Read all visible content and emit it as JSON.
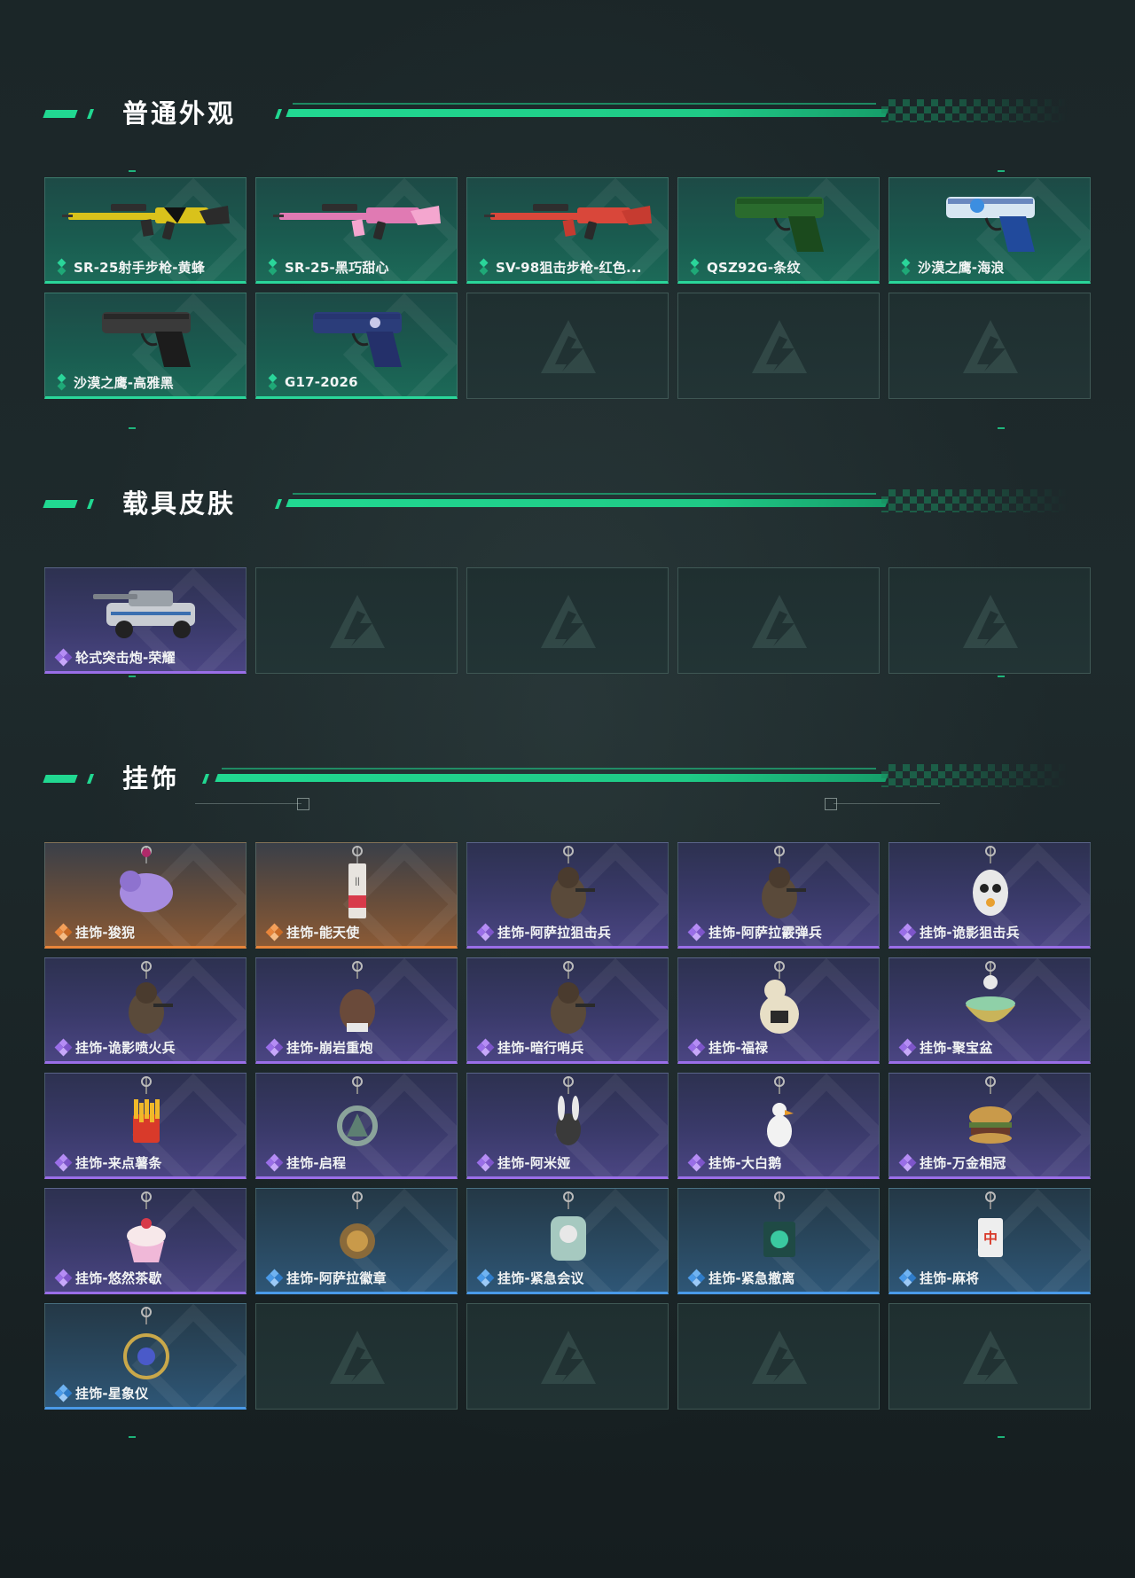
{
  "sections": [
    {
      "title": "普通外观",
      "items": [
        {
          "name": "SR-25射手步枪-黄蜂",
          "rarity": "green",
          "icon": "rifle-icon",
          "art": "rifle-yellow"
        },
        {
          "name": "SR-25-黑巧甜心",
          "rarity": "green",
          "icon": "rifle-icon",
          "art": "rifle-pink"
        },
        {
          "name": "SV-98狙击步枪-红色...",
          "rarity": "green",
          "icon": "sniper-rifle-icon",
          "art": "sniper-red"
        },
        {
          "name": "QSZ92G-条纹",
          "rarity": "green",
          "icon": "pistol-icon",
          "art": "pistol-green"
        },
        {
          "name": "沙漠之鹰-海浪",
          "rarity": "green",
          "icon": "pistol-icon",
          "art": "pistol-blue"
        },
        {
          "name": "沙漠之鹰-高雅黑",
          "rarity": "green",
          "icon": "pistol-icon",
          "art": "pistol-black"
        },
        {
          "name": "G17-2026",
          "rarity": "green",
          "icon": "pistol-icon",
          "art": "pistol-navy"
        },
        {
          "name": "",
          "rarity": "empty"
        },
        {
          "name": "",
          "rarity": "empty"
        },
        {
          "name": "",
          "rarity": "empty"
        }
      ]
    },
    {
      "title": "载具皮肤",
      "items": [
        {
          "name": "轮式突击炮-荣耀",
          "rarity": "purple",
          "icon": "vehicle-icon",
          "art": "vehicle"
        },
        {
          "name": "",
          "rarity": "empty"
        },
        {
          "name": "",
          "rarity": "empty"
        },
        {
          "name": "",
          "rarity": "empty"
        },
        {
          "name": "",
          "rarity": "empty"
        }
      ]
    },
    {
      "title": "挂饰",
      "items": [
        {
          "name": "挂饰-狻猊",
          "rarity": "orange",
          "icon": "charm-icon",
          "art": "charm-lion"
        },
        {
          "name": "挂饰-能天使",
          "rarity": "orange",
          "icon": "charm-icon",
          "art": "charm-tag"
        },
        {
          "name": "挂饰-阿萨拉狙击兵",
          "rarity": "purple",
          "icon": "charm-icon",
          "art": "charm-soldier"
        },
        {
          "name": "挂饰-阿萨拉霰弹兵",
          "rarity": "purple",
          "icon": "charm-icon",
          "art": "charm-soldier"
        },
        {
          "name": "挂饰-诡影狙击兵",
          "rarity": "purple",
          "icon": "charm-icon",
          "art": "charm-mask"
        },
        {
          "name": "挂饰-诡影喷火兵",
          "rarity": "purple",
          "icon": "charm-icon",
          "art": "charm-soldier"
        },
        {
          "name": "挂饰-崩岩重炮",
          "rarity": "purple",
          "icon": "charm-icon",
          "art": "charm-blob"
        },
        {
          "name": "挂饰-暗行哨兵",
          "rarity": "purple",
          "icon": "charm-icon",
          "art": "charm-soldier"
        },
        {
          "name": "挂饰-福禄",
          "rarity": "purple",
          "icon": "charm-icon",
          "art": "charm-gourd"
        },
        {
          "name": "挂饰-聚宝盆",
          "rarity": "purple",
          "icon": "charm-icon",
          "art": "charm-bowl"
        },
        {
          "name": "挂饰-来点薯条",
          "rarity": "purple",
          "icon": "charm-icon",
          "art": "charm-fries"
        },
        {
          "name": "挂饰-启程",
          "rarity": "purple",
          "icon": "charm-icon",
          "art": "charm-ring"
        },
        {
          "name": "挂饰-阿米娅",
          "rarity": "purple",
          "icon": "charm-icon",
          "art": "charm-bunny"
        },
        {
          "name": "挂饰-大白鹅",
          "rarity": "purple",
          "icon": "charm-icon",
          "art": "charm-goose"
        },
        {
          "name": "挂饰-万金相冠",
          "rarity": "purple",
          "icon": "charm-icon",
          "art": "charm-burger"
        },
        {
          "name": "挂饰-悠然茶歇",
          "rarity": "purple",
          "icon": "charm-icon",
          "art": "charm-cupcake"
        },
        {
          "name": "挂饰-阿萨拉徽章",
          "rarity": "blue",
          "icon": "charm-icon",
          "art": "charm-medal"
        },
        {
          "name": "挂饰-紧急会议",
          "rarity": "blue",
          "icon": "charm-icon",
          "art": "charm-badge"
        },
        {
          "name": "挂饰-紧急撤离",
          "rarity": "blue",
          "icon": "charm-icon",
          "art": "charm-box"
        },
        {
          "name": "挂饰-麻将",
          "rarity": "blue",
          "icon": "charm-icon",
          "art": "charm-mahjong"
        },
        {
          "name": "挂饰-星象仪",
          "rarity": "blue",
          "icon": "charm-icon",
          "art": "charm-astro"
        },
        {
          "name": "",
          "rarity": "empty"
        },
        {
          "name": "",
          "rarity": "empty"
        },
        {
          "name": "",
          "rarity": "empty"
        },
        {
          "name": "",
          "rarity": "empty"
        }
      ]
    }
  ],
  "colors": {
    "accent": "#21d891",
    "green_rarity": "#2ad69a",
    "purple_rarity": "#9a6ee8",
    "orange_rarity": "#e8853a",
    "blue_rarity": "#4a9ae8"
  }
}
